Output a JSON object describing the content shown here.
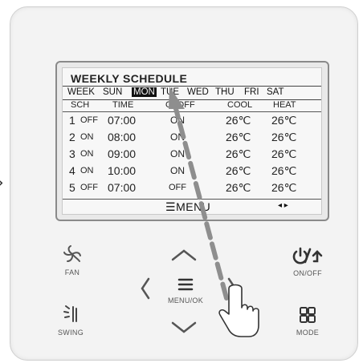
{
  "screen": {
    "title": "WEEKLY SCHEDULE",
    "week_label": "WEEK",
    "days": [
      "SUN",
      "MON",
      "TUE",
      "WED",
      "THU",
      "FRI",
      "SAT"
    ],
    "selected_day": "MON",
    "columns": [
      "SCH",
      "TIME",
      "OnOFF",
      "COOL",
      "HEAT"
    ],
    "rows": [
      {
        "num": "1",
        "state": "OFF",
        "time": "07:00",
        "onoff": "ON",
        "cool": "26℃",
        "heat": "26℃"
      },
      {
        "num": "2",
        "state": "ON",
        "time": "08:00",
        "onoff": "ON",
        "cool": "26℃",
        "heat": "26℃"
      },
      {
        "num": "3",
        "state": "ON",
        "time": "09:00",
        "onoff": "ON",
        "cool": "26℃",
        "heat": "26℃"
      },
      {
        "num": "4",
        "state": "ON",
        "time": "10:00",
        "onoff": "ON",
        "cool": "26℃",
        "heat": "26℃"
      },
      {
        "num": "5",
        "state": "OFF",
        "time": "07:00",
        "onoff": "OFF",
        "cool": "26℃",
        "heat": "26℃"
      }
    ],
    "menu_label": "MENU",
    "menu_icon": "☰",
    "nav_arrows": "◂ ▸"
  },
  "buttons": {
    "fan": {
      "label": "FAN",
      "icon": "fan-icon"
    },
    "onoff": {
      "label": "ON/OFF",
      "icon": "power-back-icon"
    },
    "menu_ok": {
      "label": "MENU/OK",
      "icon": "menu-icon"
    },
    "swing": {
      "label": "SWING",
      "icon": "swing-icon"
    },
    "mode": {
      "label": "MODE",
      "icon": "mode-grid-icon"
    },
    "up": {
      "glyph": "︿"
    },
    "down": {
      "glyph": "﹀"
    },
    "left": {
      "glyph": "〈"
    },
    "right": {
      "glyph": "〉"
    }
  },
  "annotation": {
    "side_arrow": "›"
  },
  "colors": {
    "arrow": "#8e8e8e",
    "panel": "#f3f3f3",
    "lcd": "#f7f7f7",
    "selected_bg": "#111111"
  }
}
